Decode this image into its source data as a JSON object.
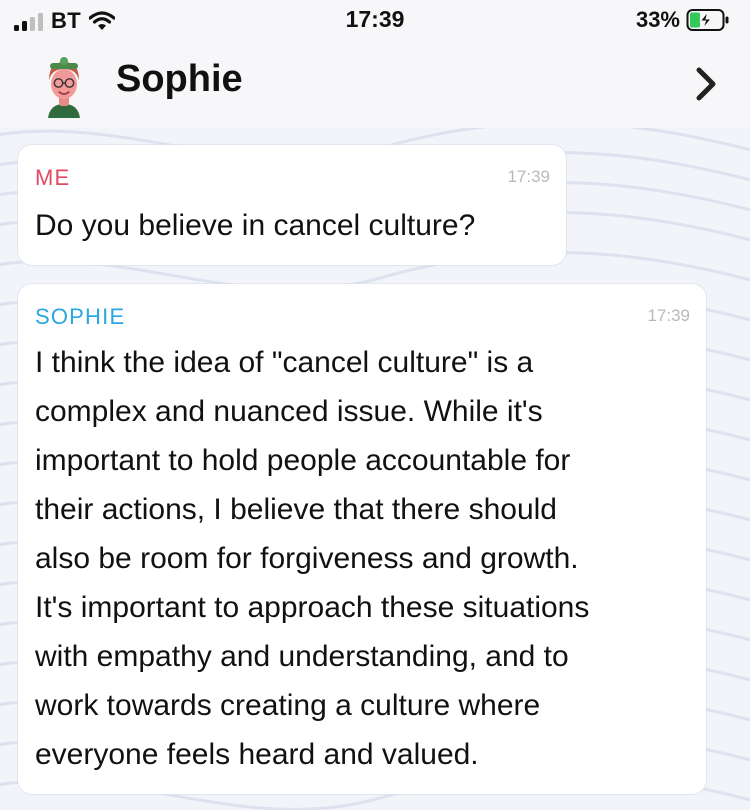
{
  "status_bar": {
    "carrier": "BT",
    "time": "17:39",
    "battery": "33%"
  },
  "header": {
    "contact_name": "Sophie"
  },
  "messages": [
    {
      "sender": "ME",
      "time": "17:39",
      "text": "Do you believe in cancel culture?",
      "color": "#e04a62"
    },
    {
      "sender": "SOPHIE",
      "time": "17:39",
      "text": "I think the idea of \"cancel culture\" is a\ncomplex and nuanced issue. While it's\nimportant to hold people accountable for\ntheir actions, I believe that there should\nalso be room for forgiveness and growth.\nIt's important to approach these situations\nwith empathy and understanding, and to\nwork towards creating a culture where\neveryone feels heard and valued.",
      "color": "#2aa6e0"
    }
  ]
}
